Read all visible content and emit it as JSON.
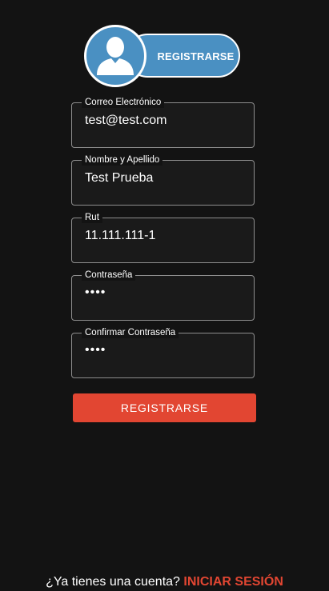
{
  "header": {
    "avatar_icon": "user-icon",
    "pill_label": "REGISTRARSE",
    "accent_color": "#4a90c2"
  },
  "form": {
    "fields": [
      {
        "label": "Correo Electrónico",
        "value": "test@test.com"
      },
      {
        "label": "Nombre y Apellido",
        "value": "Test Prueba"
      },
      {
        "label": "Rut",
        "value": "11.111.111-1"
      },
      {
        "label": "Contraseña",
        "value": "••••"
      },
      {
        "label": "Confirmar Contraseña",
        "value": "••••"
      }
    ],
    "submit_label": "REGISTRARSE",
    "submit_color": "#e24632"
  },
  "footer": {
    "prompt": "¿Ya tienes una cuenta?",
    "link": "INICIAR SESIÓN"
  }
}
